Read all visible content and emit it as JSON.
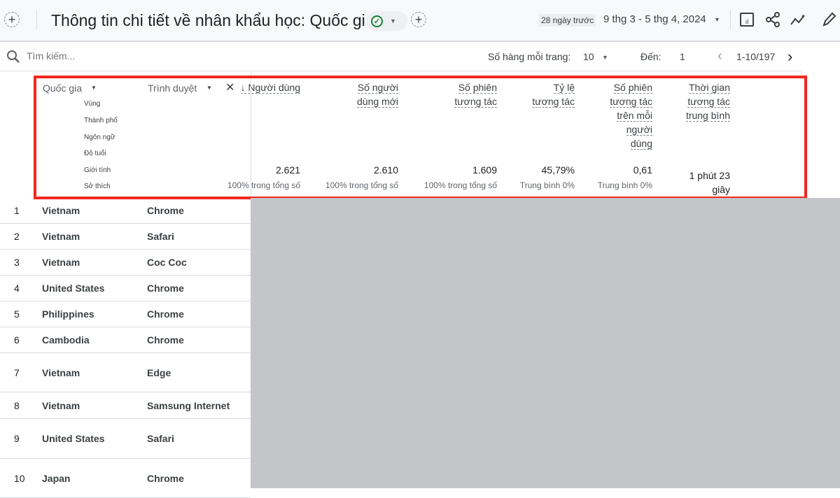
{
  "header": {
    "title": "Thông tin chi tiết về nhân khẩu học: Quốc gia",
    "date_relative": "28 ngày trước",
    "date_range": "9 thg 3 - 5 thg 4, 2024",
    "icons": [
      "add-circle-icon",
      "check-circle-icon",
      "chevron-down-icon",
      "add-circle-icon",
      "chart-edit-icon",
      "share-icon",
      "insights-icon",
      "pencil-icon"
    ]
  },
  "toolbar": {
    "search_placeholder": "Tìm kiếm...",
    "rows_per_page_label": "Số hàng mỗi trang:",
    "rows_per_page": "10",
    "goto_label": "Đến:",
    "goto_value": "1",
    "pagination": "1-10/197"
  },
  "dimensions": {
    "primary": "Quốc gia",
    "secondary": "Trình duyệt",
    "options": [
      "Vùng",
      "Thành phố",
      "Ngôn ngữ",
      "Độ tuổi",
      "Giới tính",
      "Sở thích"
    ]
  },
  "metrics": [
    {
      "label": "↓ Người dùng",
      "total": "2.621",
      "sub": "100% trong tổng số"
    },
    {
      "label": "Số người dùng mới",
      "total": "2.610",
      "sub": "100% trong tổng số"
    },
    {
      "label": "Số phiên tương tác",
      "total": "1.609",
      "sub": "100% trong tổng số"
    },
    {
      "label": "Tỷ lệ tương tác",
      "total": "45,79%",
      "sub": "Trung bình 0%"
    },
    {
      "label": "Số phiên tương tác trên mỗi người dùng",
      "total": "0,61",
      "sub": "Trung bình 0%"
    },
    {
      "label": "Thời gian tương tác trung bình",
      "total": "1 phút 23 giây",
      "sub": ""
    }
  ],
  "rows": [
    {
      "n": "1",
      "country": "Vietnam",
      "browser": "Chrome"
    },
    {
      "n": "2",
      "country": "Vietnam",
      "browser": "Safari"
    },
    {
      "n": "3",
      "country": "Vietnam",
      "browser": "Coc Coc"
    },
    {
      "n": "4",
      "country": "United States",
      "browser": "Chrome"
    },
    {
      "n": "5",
      "country": "Philippines",
      "browser": "Chrome"
    },
    {
      "n": "6",
      "country": "Cambodia",
      "browser": "Chrome"
    },
    {
      "n": "7",
      "country": "Vietnam",
      "browser": "Edge"
    },
    {
      "n": "8",
      "country": "Vietnam",
      "browser": "Samsung Internet"
    },
    {
      "n": "9",
      "country": "United States",
      "browser": "Safari"
    },
    {
      "n": "10",
      "country": "Japan",
      "browser": "Chrome"
    }
  ],
  "colors": {
    "highlight": "#f0281e",
    "overlay": "#c4c5c8",
    "success": "#188038"
  }
}
